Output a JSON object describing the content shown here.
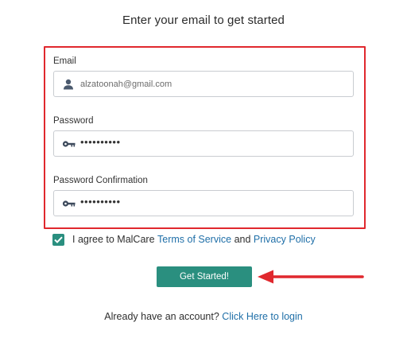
{
  "header": {
    "title": "Enter your email to get started"
  },
  "form": {
    "email": {
      "label": "Email",
      "value": "alzatoonah@gmail.com",
      "icon": "user-icon"
    },
    "password": {
      "label": "Password",
      "value": "••••••••••",
      "icon": "key-icon"
    },
    "password_confirmation": {
      "label": "Password Confirmation",
      "value": "••••••••••",
      "icon": "key-icon"
    },
    "highlight_color": "#e0282e"
  },
  "agreement": {
    "checked": true,
    "prefix": "I agree to MalCare ",
    "terms_link": "Terms of Service",
    "middle": " and ",
    "privacy_link": "Privacy Policy"
  },
  "submit": {
    "label": "Get Started!",
    "color": "#2a8f7f"
  },
  "login": {
    "prompt": "Already have an account? ",
    "link": "Click Here to login"
  },
  "colors": {
    "accent": "#2a8f7f",
    "link": "#1f6fa8",
    "annotation": "#e0282e"
  }
}
